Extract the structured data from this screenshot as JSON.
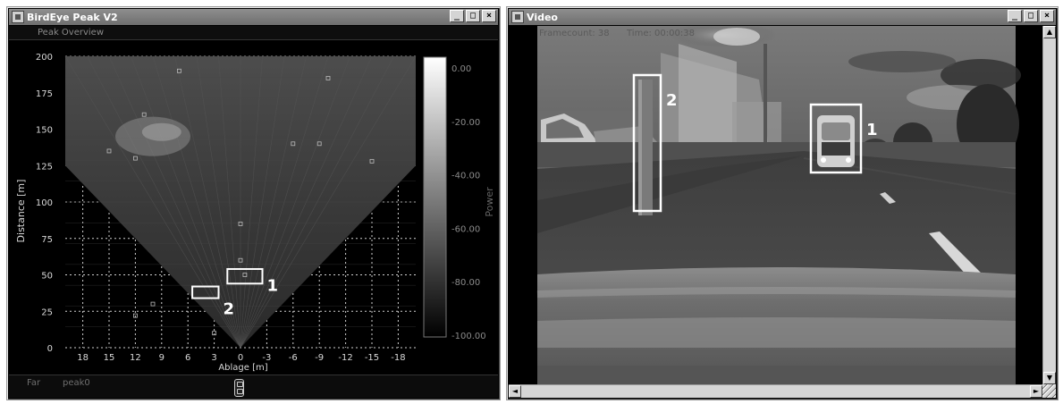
{
  "birdeye_window": {
    "title": "BirdEye Peak V2",
    "subtitle": "Peak Overview",
    "window_buttons": [
      "_",
      "□",
      "×"
    ],
    "footer": {
      "label_1": "Far",
      "label_2": "peak0"
    }
  },
  "radar_chart": {
    "y_axis_label": "Distance [m]",
    "x_axis_label": "Ablage [m]",
    "y_ticks": [
      "200",
      "175",
      "150",
      "125",
      "100",
      "75",
      "50",
      "25",
      "0"
    ],
    "x_ticks": [
      "18",
      "15",
      "12",
      "9",
      "6",
      "3",
      "0",
      "-3",
      "-6",
      "-9",
      "-12",
      "-15",
      "-18"
    ],
    "colorbar_label": "Power",
    "colorbar_ticks": [
      "0.00",
      "-20.00",
      "-40.00",
      "-60.00",
      "-80.00",
      "-100.00"
    ],
    "box_labels": [
      "1",
      "2"
    ]
  },
  "chart_data": {
    "type": "heatmap",
    "xlabel": "Ablage [m]",
    "ylabel": "Distance [m]",
    "xlim": [
      20,
      -20
    ],
    "ylim": [
      0,
      200
    ],
    "x_ticks": [
      18,
      15,
      12,
      9,
      6,
      3,
      0,
      -3,
      -6,
      -9,
      -12,
      -15,
      -18
    ],
    "y_ticks": [
      0,
      25,
      50,
      75,
      100,
      125,
      150,
      175,
      200
    ],
    "colorbar": {
      "label": "Power",
      "range": [
        0,
        -100
      ],
      "ticks": [
        0,
        -20,
        -40,
        -60,
        -80,
        -100
      ]
    },
    "grid": true,
    "highlighted_targets": [
      {
        "label": "1",
        "x_range": [
          1.5,
          -2.5
        ],
        "y_range": [
          44,
          54
        ]
      },
      {
        "label": "2",
        "x_range": [
          5.5,
          2.5
        ],
        "y_range": [
          34,
          42
        ]
      }
    ]
  },
  "video_window": {
    "title": "Video",
    "window_buttons": [
      "_",
      "□",
      "×"
    ],
    "overlay_1": "Framecount: 38",
    "overlay_2": "Time: 00:00:38",
    "box_labels": [
      "1",
      "2"
    ]
  },
  "scrollbar": {
    "up": "▲",
    "down": "▼",
    "left": "◄",
    "right": "►"
  }
}
